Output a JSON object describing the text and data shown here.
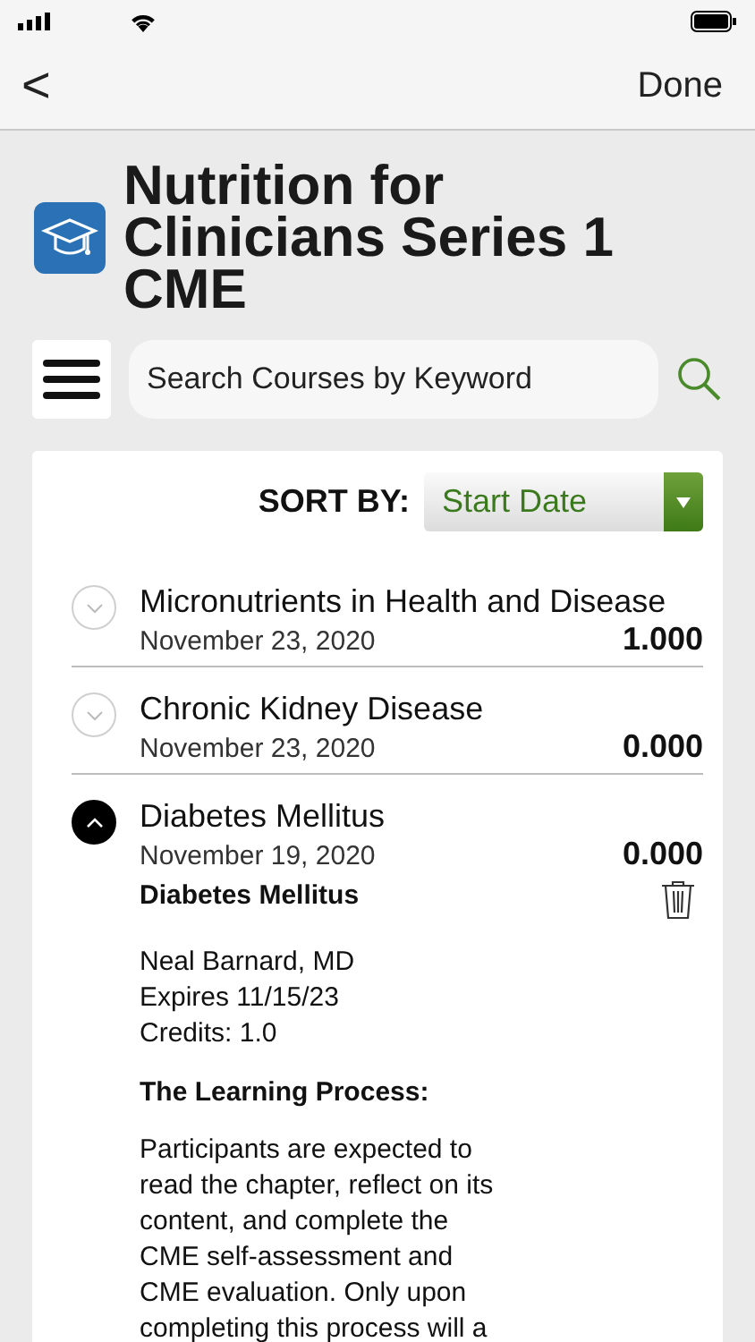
{
  "nav": {
    "back": "<",
    "done": "Done"
  },
  "header": {
    "title": "Nutrition for Clinicians Series 1 CME"
  },
  "search": {
    "placeholder": "Search Courses by Keyword"
  },
  "sort": {
    "label": "SORT BY:",
    "value": "Start Date"
  },
  "courses": [
    {
      "title": "Micronutrients in Health and Disease",
      "date": "November 23, 2020",
      "credits": "1.000",
      "expanded": false
    },
    {
      "title": "Chronic Kidney Disease",
      "date": "November 23, 2020",
      "credits": "0.000",
      "expanded": false
    },
    {
      "title": "Diabetes Mellitus",
      "date": "November 19, 2020",
      "credits": "0.000",
      "expanded": true,
      "detail": {
        "name": "Diabetes Mellitus",
        "info": [
          "Neal Barnard, MD",
          "Expires 11/15/23",
          "Credits: 1.0"
        ],
        "heading": "The Learning Process:",
        "paragraph_lines": [
          "Participants are expected to",
          "read the chapter, reflect on its",
          "content, and complete the",
          "CME self-assessment and",
          "CME evaluation. Only upon",
          "completing this process will a"
        ]
      }
    }
  ]
}
